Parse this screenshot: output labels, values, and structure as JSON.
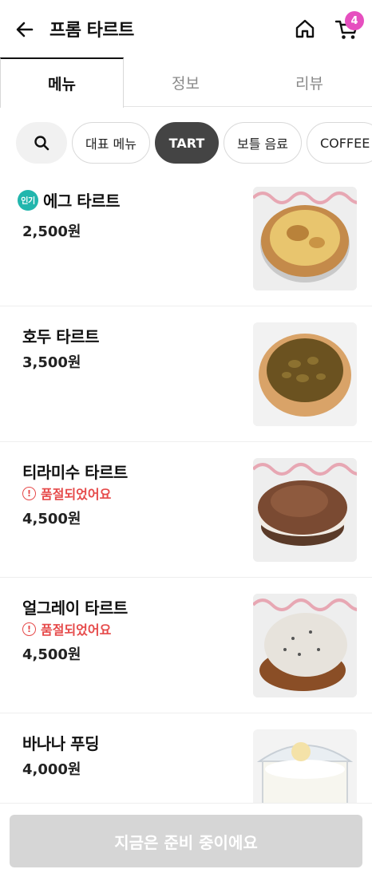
{
  "header": {
    "title": "프롬 타르트",
    "back_icon": "arrow-left-icon",
    "home_icon": "home-icon",
    "cart_icon": "cart-icon",
    "cart_count": "4",
    "badge_color": "#e64fbf"
  },
  "tabs": [
    {
      "label": "메뉴",
      "active": true
    },
    {
      "label": "정보",
      "active": false
    },
    {
      "label": "리뷰",
      "active": false
    }
  ],
  "categories": {
    "search_icon": "search-icon",
    "items": [
      {
        "label": "대표 메뉴",
        "active": false
      },
      {
        "label": "TART",
        "active": true
      },
      {
        "label": "보틀 음료",
        "active": false
      },
      {
        "label": "COFFEE",
        "active": false
      }
    ]
  },
  "menu": {
    "popular_label": "인기",
    "soldout_label": "품절되었어요",
    "items": [
      {
        "name": "에그 타르트",
        "price": "2,500원",
        "popular": true,
        "soldout": false
      },
      {
        "name": "호두 타르트",
        "price": "3,500원",
        "popular": false,
        "soldout": false
      },
      {
        "name": "티라미수 타르트",
        "price": "4,500원",
        "popular": false,
        "soldout": true
      },
      {
        "name": "얼그레이 타르트",
        "price": "4,500원",
        "popular": false,
        "soldout": true
      },
      {
        "name": "바나나 푸딩",
        "price": "4,000원",
        "popular": false,
        "soldout": false
      }
    ]
  },
  "footer": {
    "cta_label": "지금은 준비 중이에요"
  }
}
